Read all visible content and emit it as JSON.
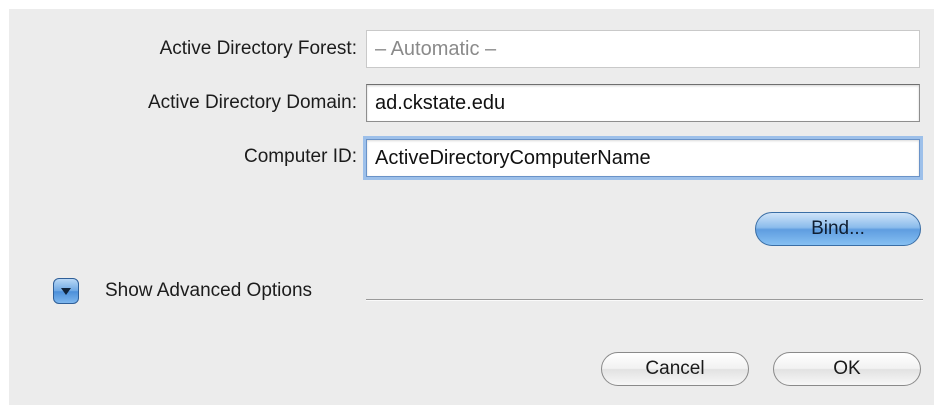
{
  "form": {
    "forest": {
      "label": "Active Directory Forest:",
      "placeholder": "– Automatic –",
      "value": ""
    },
    "domain": {
      "label": "Active Directory Domain:",
      "value": "ad.ckstate.edu"
    },
    "computer_id": {
      "label": "Computer ID:",
      "value": "ActiveDirectoryComputerName"
    }
  },
  "bind_button": {
    "label": "Bind..."
  },
  "advanced": {
    "label": "Show Advanced Options",
    "icon": "disclosure-triangle-down-icon"
  },
  "footer": {
    "cancel_label": "Cancel",
    "ok_label": "OK"
  },
  "colors": {
    "dialog_background": "#ececec",
    "aqua_accent": "#5f9de0",
    "focus_ring": "#9dc0ea"
  }
}
